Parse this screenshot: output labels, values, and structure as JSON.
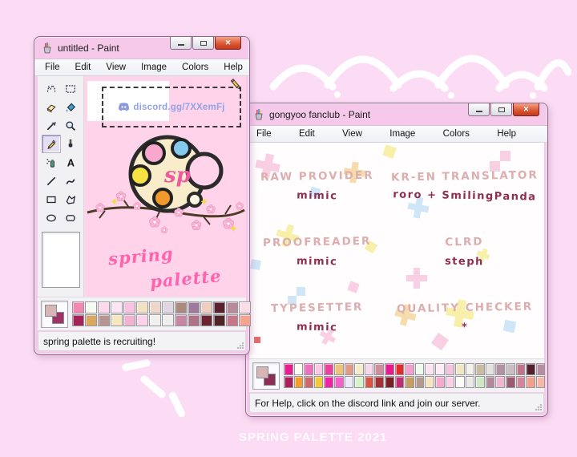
{
  "page": {
    "watermark": "SPRING PALETTE 2021"
  },
  "colors": {
    "desktop_background": "#fbdcf4",
    "canvas_pink": "#ffd3e9",
    "discord_link": "#93a3e6",
    "credit_role": "#dcaeae",
    "credit_name": "#8e2d50",
    "script_pink": "#ff63ad",
    "cross_pink": "#f9cfe3",
    "cross_yellow": "#f8f0a8",
    "cross_blue": "#cfe5f8",
    "cross_orange": "#f7dcab",
    "cross_red": "#e96a6a"
  },
  "left_window": {
    "title": "untitled - Paint",
    "menu": [
      "File",
      "Edit",
      "View",
      "Image",
      "Colors",
      "Help"
    ],
    "tools": [
      "free-form-select",
      "select",
      "eraser",
      "fill",
      "color-picker",
      "magnifier",
      "pencil",
      "brush",
      "airbrush",
      "text",
      "line",
      "curve",
      "rectangle",
      "polygon",
      "ellipse",
      "rounded-rectangle"
    ],
    "selected_tool": "pencil",
    "canvas": {
      "discord_link": "discord.gg/7XXemFj",
      "logo_monogram": "sp",
      "script_line1": "spring",
      "script_line2": "palette"
    },
    "palette": {
      "foreground": "#d9b6b6",
      "background": "#9e3366",
      "rows": [
        [
          "#f287b2",
          "#f6fbf1",
          "#fbd9ea",
          "#fde6f3",
          "#f8c3e0",
          "#f2e2c2",
          "#eed7c8",
          "#e2d5e2",
          "#a98a7b",
          "#9f7b9b",
          "#eecebe",
          "#5c1f2e",
          "#b78a9c",
          "#fadee7"
        ],
        [
          "#a32458",
          "#d9a75f",
          "#b59693",
          "#f7e7c0",
          "#f2b3d1",
          "#fbd3e8",
          "#f2f0ec",
          "#eeeeea",
          "#c786a4",
          "#b07286",
          "#6b2430",
          "#4f2428",
          "#c4788a",
          "#f2a48f"
        ]
      ]
    },
    "status": "spring palette is recruiting!"
  },
  "right_window": {
    "title": "gongyoo fanclub - Paint",
    "menu": [
      "File",
      "Edit",
      "View",
      "Image",
      "Colors",
      "Help"
    ],
    "credits": [
      {
        "role": "RAW PROVIDER",
        "name": "mimic"
      },
      {
        "role": "KR-EN TRANSLATOR",
        "name": "roro + SmilingPanda"
      },
      {
        "role": "PROOFREADER",
        "name": "mimic"
      },
      {
        "role": "CLRD",
        "name": "steph"
      },
      {
        "role": "TYPESETTER",
        "name": "mimic"
      },
      {
        "role": "QUALITY CHECKER",
        "name": "*"
      }
    ],
    "palette": {
      "foreground": "#d9b6b6",
      "background": "#8e2d55",
      "rows": [
        [
          "#ec1a90",
          "#fbfdf3",
          "#f06ec0",
          "#fbc9e6",
          "#ef3f9e",
          "#eec277",
          "#e09a86",
          "#f7ecca",
          "#f7d7e8",
          "#cf8f9a",
          "#e9188e",
          "#e52a2d",
          "#f2a2ca",
          "#eefbea",
          "#fce4f1",
          "#fdecf5",
          "#f6c3dc",
          "#f2e7c5",
          "#f5f2ec",
          "#c9bda1",
          "#e5e1dc",
          "#b291a0",
          "#c9bfc1",
          "#c17489",
          "#54202c",
          "#b58f9e"
        ],
        [
          "#ab1f5c",
          "#f59d27",
          "#cb6a6e",
          "#f3c935",
          "#ee22a2",
          "#f460c8",
          "#efe7fb",
          "#d8f3cc",
          "#da5540",
          "#a62f34",
          "#7a1f24",
          "#c42a72",
          "#c99d62",
          "#b39a8c",
          "#f7e3c1",
          "#f4aacd",
          "#fbd1e6",
          "#fdfbf7",
          "#eceae6",
          "#cfe8c4",
          "#b08a9a",
          "#f0b6d0",
          "#9c5a72",
          "#d4849c",
          "#f2a08c",
          "#f7b9a4"
        ]
      ]
    },
    "status": "For Help, click on the discord link and join our server."
  }
}
